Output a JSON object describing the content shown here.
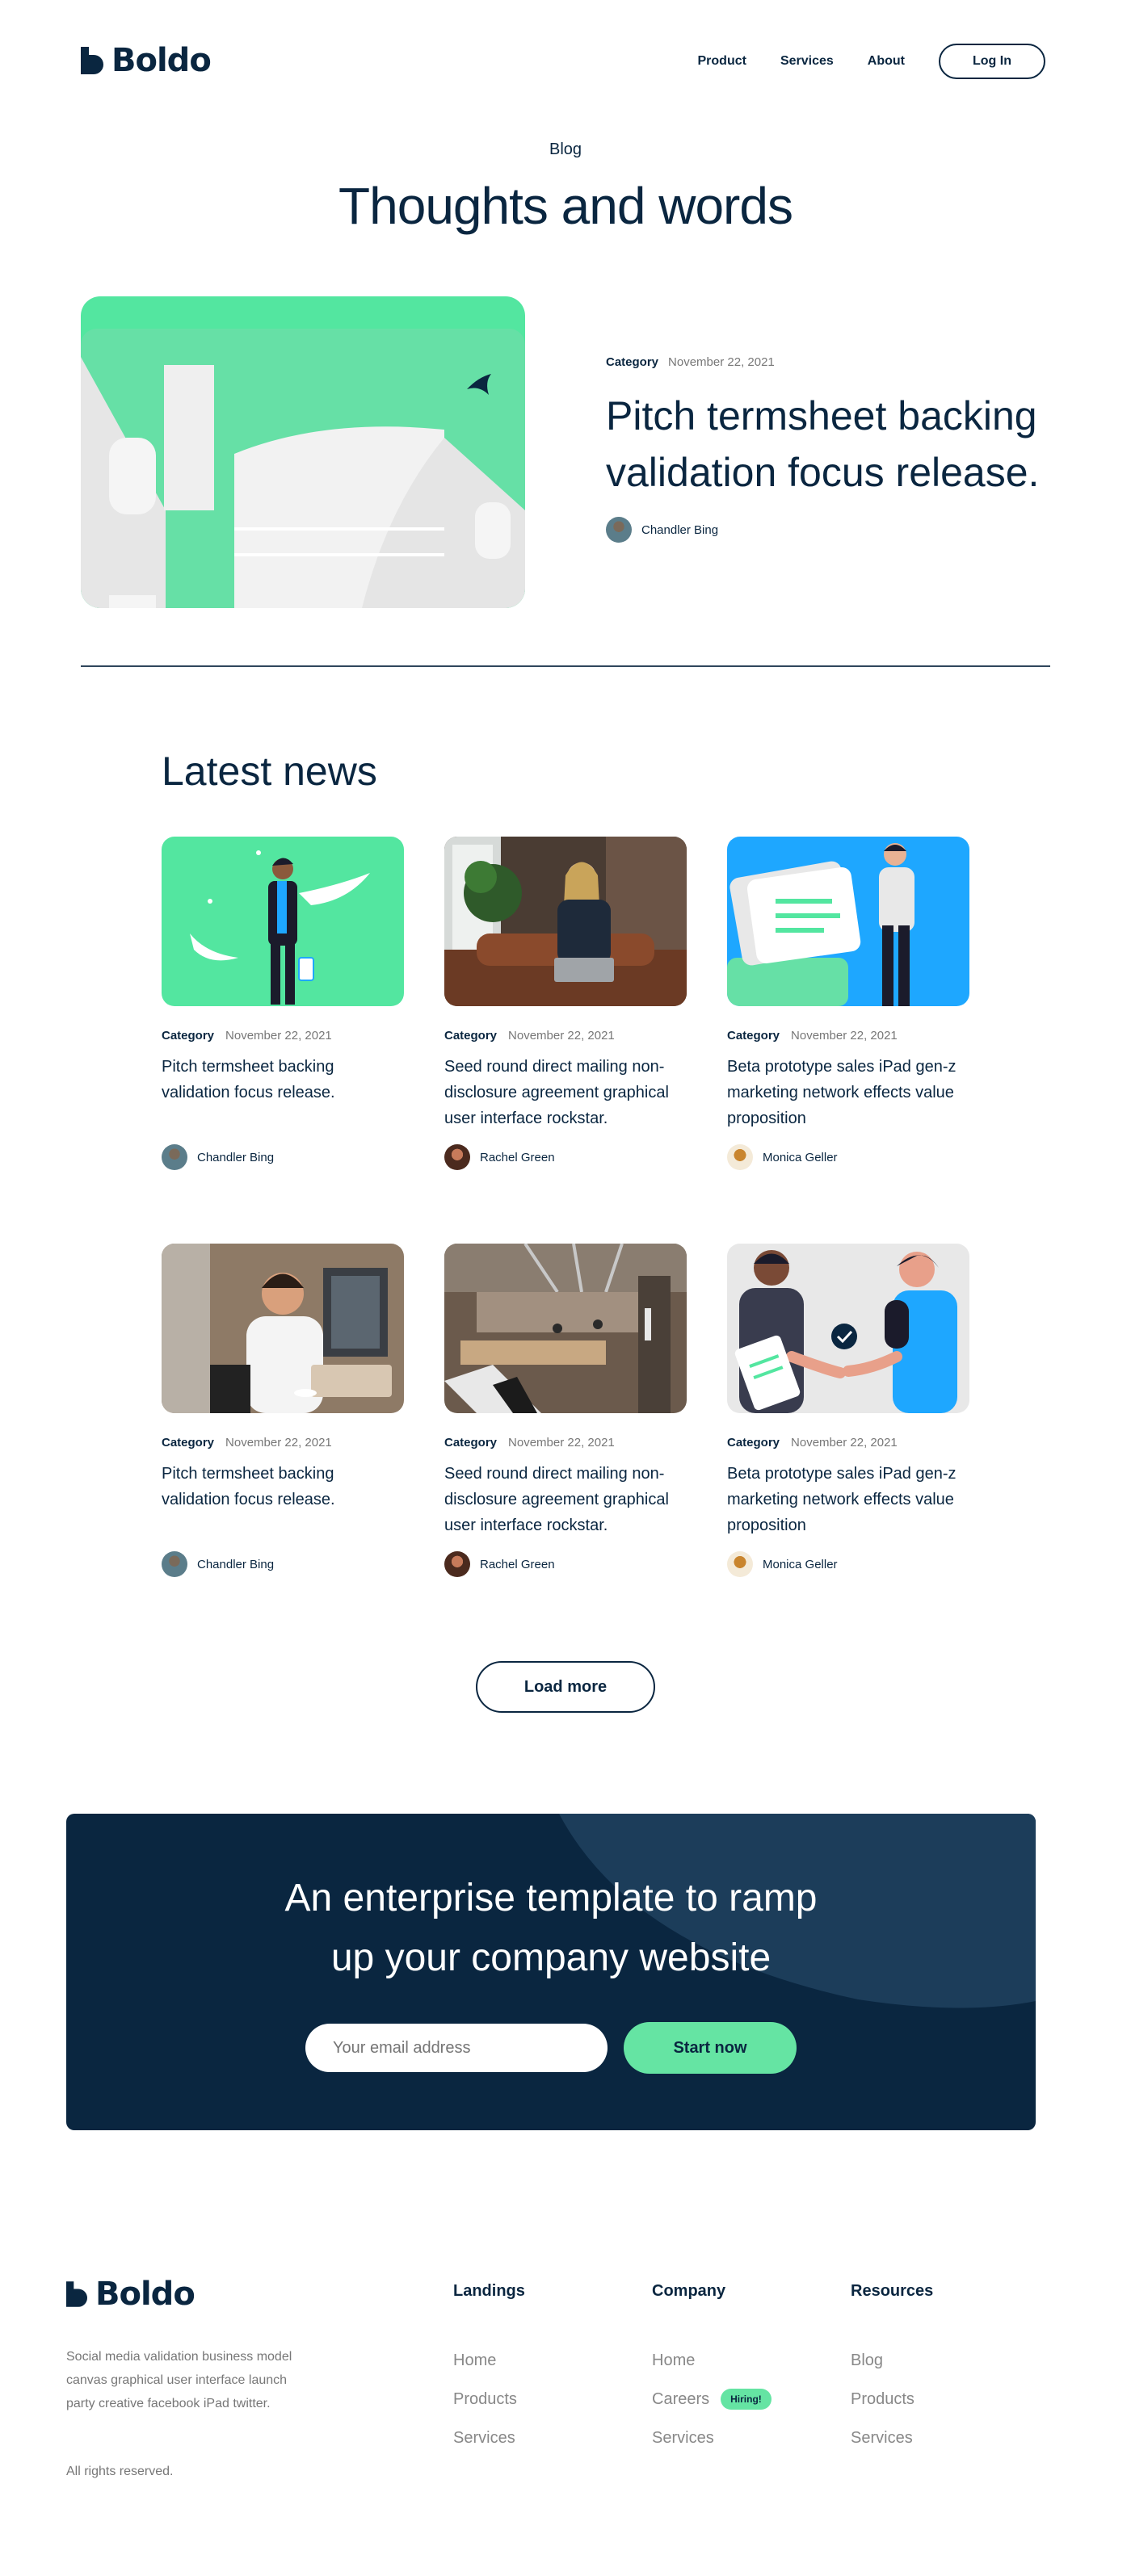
{
  "brand": {
    "name": "Boldo",
    "color_dark": "#0a2640",
    "color_accent": "#65e4a3"
  },
  "nav": {
    "items": [
      "Product",
      "Services",
      "About"
    ],
    "login": "Log In"
  },
  "hero": {
    "eyebrow": "Blog",
    "title": "Thoughts and words"
  },
  "featured": {
    "category": "Category",
    "date": "November 22, 2021",
    "title": "Pitch termsheet backing validation focus release.",
    "author": "Chandler Bing"
  },
  "latest": {
    "title": "Latest news",
    "cards": [
      {
        "category": "Category",
        "date": "November 22, 2021",
        "title": "Pitch termsheet backing validation focus release.",
        "author": "Chandler Bing"
      },
      {
        "category": "Category",
        "date": "November 22, 2021",
        "title": "Seed round direct mailing non-disclosure agreement graphical user interface rockstar.",
        "author": "Rachel Green"
      },
      {
        "category": "Category",
        "date": "November 22, 2021",
        "title": "Beta prototype sales iPad gen-z marketing network effects value proposition",
        "author": "Monica Geller"
      },
      {
        "category": "Category",
        "date": "November 22, 2021",
        "title": "Pitch termsheet backing validation focus release.",
        "author": "Chandler Bing"
      },
      {
        "category": "Category",
        "date": "November 22, 2021",
        "title": "Seed round direct mailing non-disclosure agreement graphical user interface rockstar.",
        "author": "Rachel Green"
      },
      {
        "category": "Category",
        "date": "November 22, 2021",
        "title": "Beta prototype sales iPad gen-z marketing network effects value proposition",
        "author": "Monica Geller"
      }
    ],
    "load_more": "Load more"
  },
  "cta": {
    "title_line1": "An enterprise template to ramp",
    "title_line2": "up your company website",
    "email_placeholder": "Your email address",
    "button": "Start now"
  },
  "footer": {
    "brand": "Boldo",
    "description": "Social media validation business model canvas graphical user interface launch party creative facebook iPad twitter.",
    "rights": "All rights reserved.",
    "columns": [
      {
        "heading": "Landings",
        "links": [
          "Home",
          "Products",
          "Services"
        ]
      },
      {
        "heading": "Company",
        "links": [
          "Home",
          "Careers",
          "Services"
        ],
        "badge": "Hiring!"
      },
      {
        "heading": "Resources",
        "links": [
          "Blog",
          "Products",
          "Services"
        ]
      }
    ]
  }
}
